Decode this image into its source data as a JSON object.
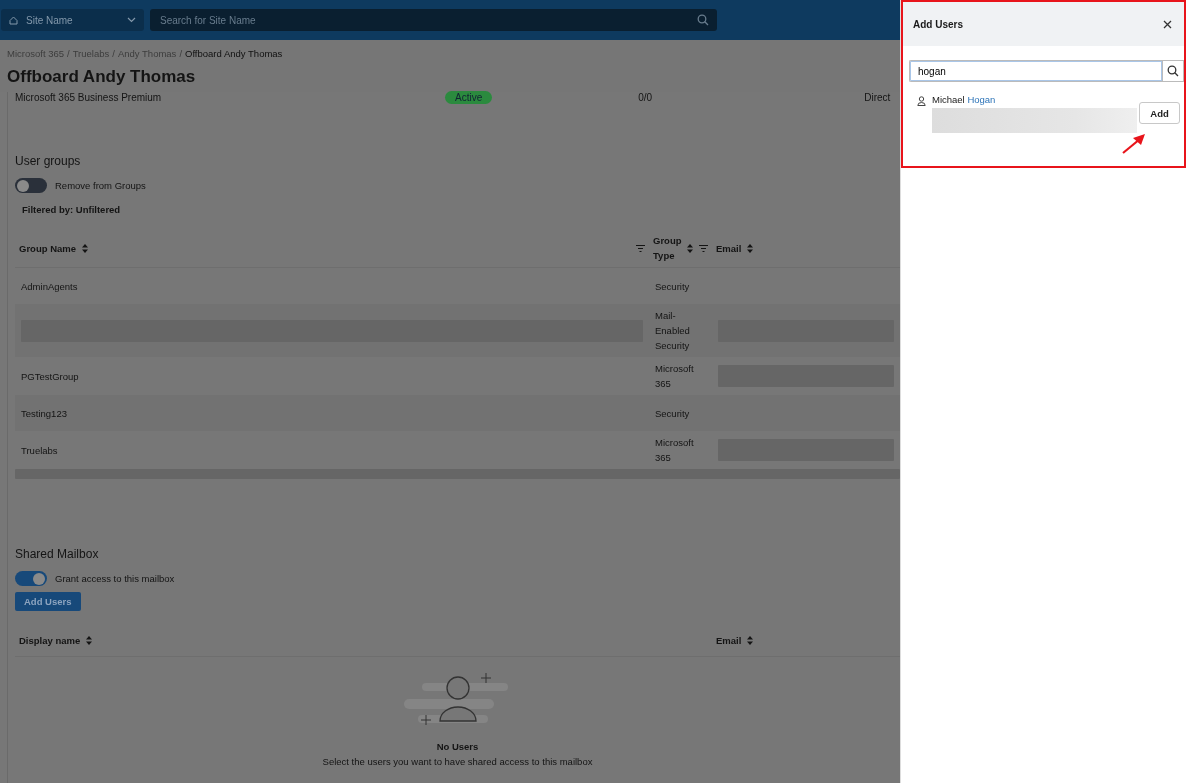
{
  "header": {
    "site_select": "Site Name",
    "search_placeholder": "Search for Site Name"
  },
  "breadcrumb": [
    {
      "label": "Microsoft 365",
      "separator": "/"
    },
    {
      "label": "Truelabs",
      "separator": "/"
    },
    {
      "label": "Andy Thomas",
      "separator": "/"
    },
    {
      "label": "Offboard Andy Thomas"
    }
  ],
  "title": "Offboard Andy Thomas",
  "license_row": {
    "name": "Microsoft 365 Business Premium",
    "status": "Active",
    "count": "0/0",
    "assignment": "Direct"
  },
  "user_groups": {
    "heading": "User groups",
    "toggle": {
      "label": "Remove from Groups",
      "on": false
    },
    "filter": "Filtered by: Unfiltered",
    "columns": [
      "Group Name",
      "Group Type",
      "Email"
    ],
    "rows": [
      {
        "name": "AdminAgents",
        "name_redacted": false,
        "type": "Security",
        "email_redacted": false
      },
      {
        "name_redacted": true,
        "type": "Mail-Enabled Security",
        "email_redacted": true
      },
      {
        "name": "PGTestGroup",
        "name_redacted": false,
        "type": "Microsoft 365",
        "email_redacted": true
      },
      {
        "name": "Testing123",
        "name_redacted": false,
        "type": "Security",
        "email_redacted": false
      },
      {
        "name": "Truelabs",
        "name_redacted": false,
        "type": "Microsoft 365",
        "email_redacted": true
      }
    ]
  },
  "shared_mailbox": {
    "heading": "Shared Mailbox",
    "toggle": {
      "label": "Grant access to this mailbox",
      "on": true
    },
    "button": "Add Users",
    "columns": [
      "Display name",
      "Email"
    ],
    "empty_title": "No Users",
    "empty_message": "Select the users you want to have shared access to this mailbox"
  },
  "drawer": {
    "title": "Add Users",
    "search_value": "hogan",
    "results": [
      {
        "name_parts": [
          {
            "text": "Michael ",
            "highlight": false
          },
          {
            "text": "Hogan",
            "highlight": true
          }
        ],
        "button": "Add"
      }
    ]
  }
}
